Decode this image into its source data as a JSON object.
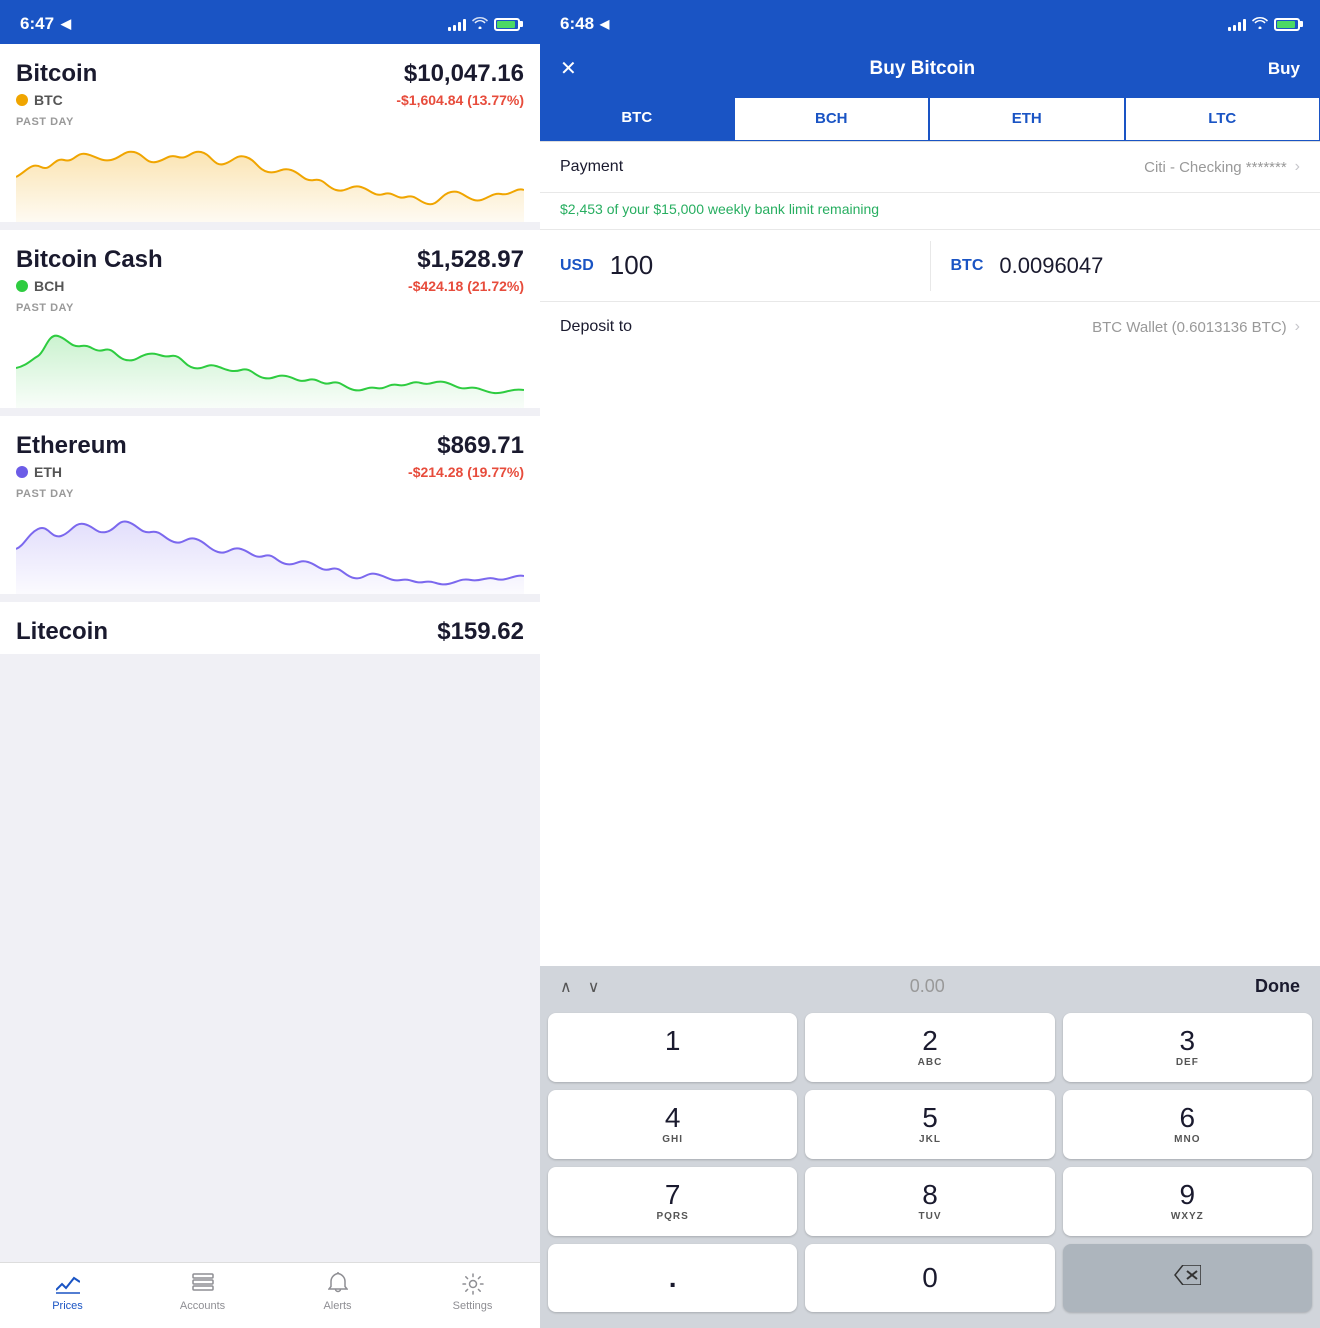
{
  "left": {
    "statusBar": {
      "time": "6:47",
      "locationIcon": "▶",
      "signalBars": [
        4,
        6,
        8,
        10,
        12
      ],
      "battery": "🔋"
    },
    "coins": [
      {
        "name": "Bitcoin",
        "symbol": "BTC",
        "dotColor": "#f0a500",
        "price": "$10,047.16",
        "change": "-$1,604.84 (13.77%)",
        "period": "PAST DAY",
        "chartColor": "#f0a500",
        "chartFill": "rgba(240,165,0,0.15)"
      },
      {
        "name": "Bitcoin Cash",
        "symbol": "BCH",
        "dotColor": "#2ecc40",
        "price": "$1,528.97",
        "change": "-$424.18 (21.72%)",
        "period": "PAST DAY",
        "chartColor": "#2ecc40",
        "chartFill": "rgba(46,204,64,0.12)"
      },
      {
        "name": "Ethereum",
        "symbol": "ETH",
        "dotColor": "#6c5ce7",
        "price": "$869.71",
        "change": "-$214.28 (19.77%)",
        "period": "PAST DAY",
        "chartColor": "#7b68ee",
        "chartFill": "rgba(123,104,238,0.12)"
      }
    ],
    "ltcPartial": {
      "name": "Litecoin",
      "price": "$159.62"
    },
    "tabBar": {
      "items": [
        {
          "id": "prices",
          "label": "Prices",
          "active": true
        },
        {
          "id": "accounts",
          "label": "Accounts",
          "active": false
        },
        {
          "id": "alerts",
          "label": "Alerts",
          "active": false
        },
        {
          "id": "settings",
          "label": "Settings",
          "active": false
        }
      ]
    }
  },
  "right": {
    "statusBar": {
      "time": "6:48",
      "locationIcon": "▶"
    },
    "header": {
      "title": "Buy Bitcoin",
      "closeLabel": "✕",
      "actionLabel": "Buy"
    },
    "currencyTabs": [
      {
        "id": "btc",
        "label": "BTC",
        "active": true
      },
      {
        "id": "bch",
        "label": "BCH",
        "active": false
      },
      {
        "id": "eth",
        "label": "ETH",
        "active": false
      },
      {
        "id": "ltc",
        "label": "LTC",
        "active": false
      }
    ],
    "payment": {
      "label": "Payment",
      "value": "Citi - Checking *******"
    },
    "limitNotice": "$2,453 of your $15,000 weekly bank limit remaining",
    "usdAmount": {
      "currency": "USD",
      "value": "100"
    },
    "btcAmount": {
      "currency": "BTC",
      "value": "0.0096047"
    },
    "deposit": {
      "label": "Deposit to",
      "value": "BTC Wallet (0.6013136 BTC)"
    },
    "keyboard": {
      "toolbarAmount": "0.00",
      "toolbarDone": "Done",
      "keys": [
        {
          "number": "1",
          "letters": ""
        },
        {
          "number": "2",
          "letters": "ABC"
        },
        {
          "number": "3",
          "letters": "DEF"
        },
        {
          "number": "4",
          "letters": "GHI"
        },
        {
          "number": "5",
          "letters": "JKL"
        },
        {
          "number": "6",
          "letters": "MNO"
        },
        {
          "number": "7",
          "letters": "PQRS"
        },
        {
          "number": "8",
          "letters": "TUV"
        },
        {
          "number": "9",
          "letters": "WXYZ"
        },
        {
          "number": ".",
          "letters": "",
          "type": "dot"
        },
        {
          "number": "0",
          "letters": "",
          "type": "zero"
        },
        {
          "number": "⌫",
          "letters": "",
          "type": "delete"
        }
      ]
    }
  }
}
